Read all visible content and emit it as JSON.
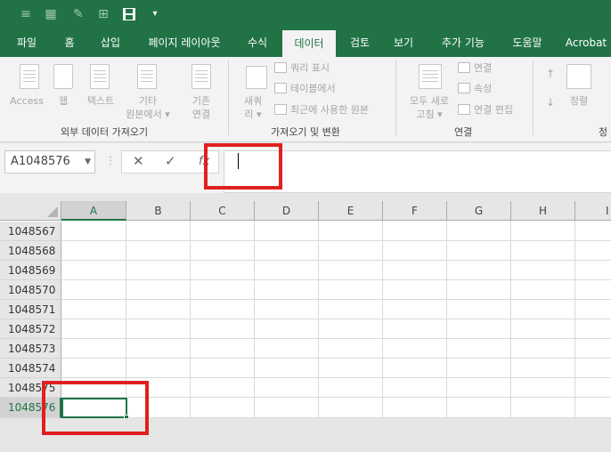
{
  "quick_access": {
    "icons": [
      "menu-icon",
      "form-icon",
      "brush-icon",
      "table-icon",
      "save-icon",
      "customize-dropdown-icon"
    ]
  },
  "tabs": [
    {
      "label": "파일"
    },
    {
      "label": "홈"
    },
    {
      "label": "삽입"
    },
    {
      "label": "페이지 레이아웃"
    },
    {
      "label": "수식"
    },
    {
      "label": "데이터"
    },
    {
      "label": "검토"
    },
    {
      "label": "보기"
    },
    {
      "label": "추가 기능"
    },
    {
      "label": "도움말"
    },
    {
      "label": "Acrobat"
    }
  ],
  "active_tab": "데이터",
  "ribbon": {
    "access": "Access",
    "web": "웹",
    "text": "텍스트",
    "other_1": "기타",
    "other_2": "원본에서 ▾",
    "existing_1": "기존",
    "existing_2": "연결",
    "group_external": "외부 데이터 가져오기",
    "new_query_1": "새쿼",
    "new_query_2": "리 ▾",
    "show_query": "쿼리 표시",
    "from_table": "테이블에서",
    "recent_sources": "최근에 사용한 원본",
    "group_get_transform": "가져오기 및 변환",
    "refresh_1": "모두 새로",
    "refresh_2": "고침 ▾",
    "connections": "연결",
    "properties": "속성",
    "edit_links": "연결 편집",
    "group_connections": "연결",
    "sort": "정렬",
    "group_sort_partial": "정"
  },
  "formula_bar": {
    "name_box": "A1048576",
    "cancel": "✕",
    "enter": "✓",
    "fx": "fx",
    "formula": ""
  },
  "columns": [
    "A",
    "B",
    "C",
    "D",
    "E",
    "F",
    "G",
    "H",
    "I"
  ],
  "rows": [
    "1048567",
    "1048568",
    "1048569",
    "1048570",
    "1048571",
    "1048572",
    "1048573",
    "1048574",
    "1048575",
    "1048576"
  ],
  "selection": {
    "column": "A",
    "row": "1048576"
  },
  "colors": {
    "excel_green": "#217346",
    "highlight_red": "#e0201f"
  }
}
